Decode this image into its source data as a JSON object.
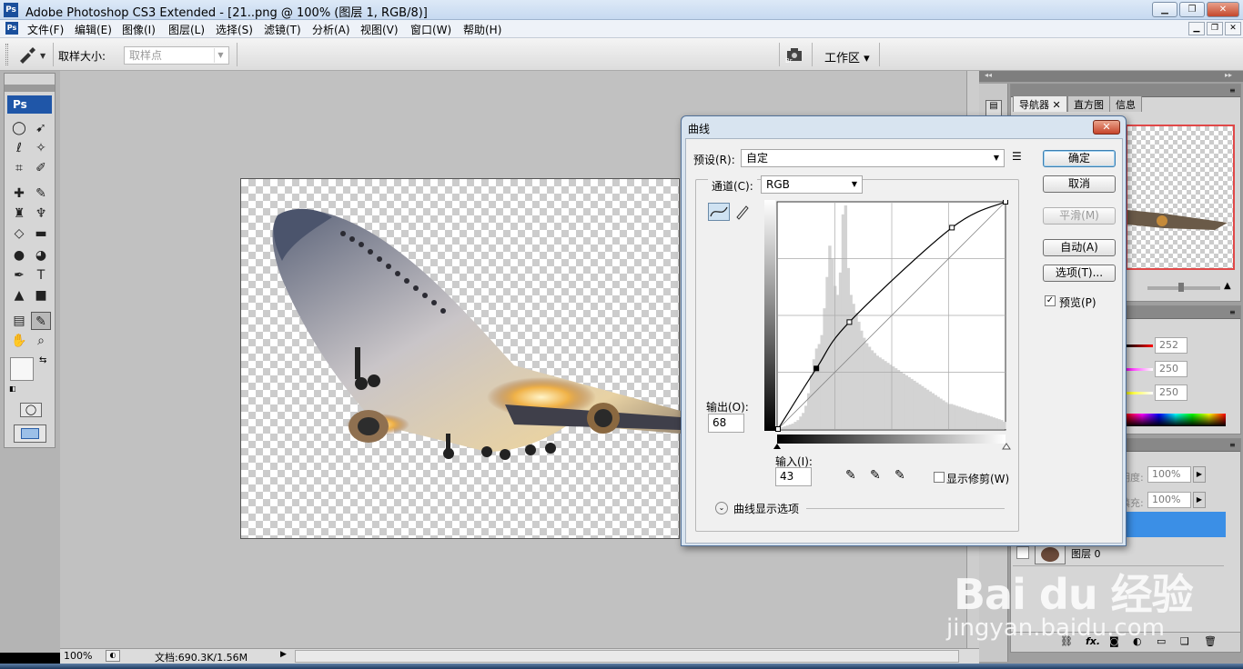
{
  "app": {
    "title": "Adobe Photoshop CS3 Extended - [21..png @ 100% (图层 1, RGB/8)]",
    "logo": "Ps",
    "min_label": "▁",
    "max_label": "❐",
    "close_label": "✕"
  },
  "menu": {
    "items": [
      "文件(F)",
      "编辑(E)",
      "图像(I)",
      "图层(L)",
      "选择(S)",
      "滤镜(T)",
      "分析(A)",
      "视图(V)",
      "窗口(W)",
      "帮助(H)"
    ]
  },
  "options_bar": {
    "sample_size_label": "取样大小:",
    "sample_size_value": "取样点",
    "workspace_label": "工作区 ▾"
  },
  "toolbox": {
    "logo": "Ps",
    "icons": [
      "marquee-icon",
      "move-icon",
      "lasso-icon",
      "magic-wand-icon",
      "crop-icon",
      "slice-icon",
      "healing-brush-icon",
      "brush-icon",
      "clone-stamp-icon",
      "history-brush-icon",
      "eraser-icon",
      "gradient-icon",
      "blur-icon",
      "dodge-icon",
      "pen-icon",
      "type-icon",
      "path-selection-icon",
      "shape-icon",
      "notes-icon",
      "eyedropper-icon",
      "hand-icon",
      "zoom-icon"
    ]
  },
  "status_bar": {
    "zoom": "100%",
    "doc_info": "文档:690.3K/1.56M"
  },
  "panels": {
    "tabs": [
      "导航器",
      "直方图",
      "信息"
    ],
    "rgb_values": [
      "252",
      "250",
      "250"
    ],
    "opacity_label": "明度:",
    "opacity_value": "100%",
    "fill_label": "填充:",
    "fill_value": "100%",
    "layer_name": "图层 0",
    "fx_label": "fx."
  },
  "curves_dialog": {
    "title": "曲线",
    "preset_label": "预设(R):",
    "preset_value": "自定",
    "channel_label": "通道(C):",
    "channel_value": "RGB",
    "ok": "确定",
    "cancel": "取消",
    "smooth": "平滑(M)",
    "auto": "自动(A)",
    "options": "选项(T)...",
    "preview_label": "预览(P)",
    "preview_checked": true,
    "output_label": "输出(O):",
    "output_value": "68",
    "input_label": "输入(I):",
    "input_value": "43",
    "show_clipping_label": "显示修剪(W)",
    "show_clipping_checked": false,
    "curve_display_options": "曲线显示选项"
  },
  "chart_data": {
    "type": "line",
    "title": "",
    "xlabel": "输入(I):",
    "ylabel": "输出(O):",
    "xlim": [
      0,
      255
    ],
    "ylim": [
      0,
      255
    ],
    "grid": true,
    "series": [
      {
        "points": [
          [
            0,
            0
          ],
          [
            43,
            68
          ],
          [
            80,
            120
          ],
          [
            195,
            226
          ],
          [
            255,
            255
          ]
        ]
      }
    ],
    "selected_point": [
      43,
      68
    ],
    "histogram": [
      0,
      2,
      3,
      4,
      5,
      6,
      8,
      10,
      14,
      18,
      26,
      40,
      60,
      78,
      90,
      95,
      105,
      135,
      170,
      205,
      190,
      160,
      150,
      175,
      240,
      250,
      180,
      150,
      140,
      130,
      120,
      110,
      102,
      96,
      92,
      88,
      85,
      82,
      80,
      78,
      76,
      74,
      72,
      70,
      68,
      66,
      64,
      62,
      60,
      58,
      56,
      54,
      52,
      50,
      48,
      46,
      44,
      42,
      40,
      38,
      36,
      34,
      32,
      30,
      28,
      28,
      27,
      26,
      25,
      24,
      23,
      22,
      21,
      20,
      19,
      18,
      18,
      17,
      16,
      15,
      14,
      13,
      12,
      11,
      10,
      8
    ]
  },
  "watermark": {
    "text1": "Bai du 经验",
    "text2": "jingyan.baidu.com"
  },
  "colors": {
    "accent": "#3f8fd2",
    "dialog_bg": "#f0f0f0",
    "canvas_bg": "#c1c1c1"
  }
}
